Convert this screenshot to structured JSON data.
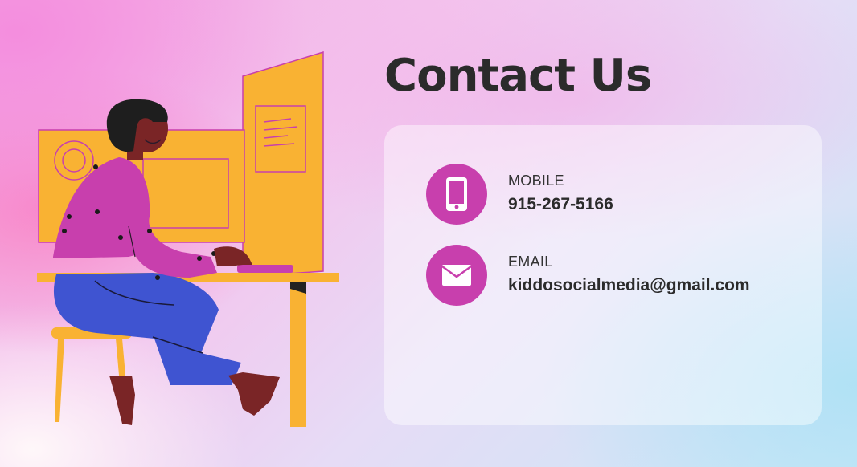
{
  "page": {
    "title": "Contact Us"
  },
  "contacts": [
    {
      "label": "MOBILE",
      "value": "915-267-5166",
      "icon": "phone-icon"
    },
    {
      "label": "EMAIL",
      "value": "kiddosocialmedia@gmail.com",
      "icon": "mail-icon"
    }
  ],
  "colors": {
    "accent": "#c83fad",
    "title": "#2b2b2b",
    "card": "rgba(255,255,255,0.45)",
    "monitor": "#f9b233",
    "trousers": "#3f54d1"
  },
  "illustration": {
    "subject": "person-working-at-computer-illustration"
  }
}
